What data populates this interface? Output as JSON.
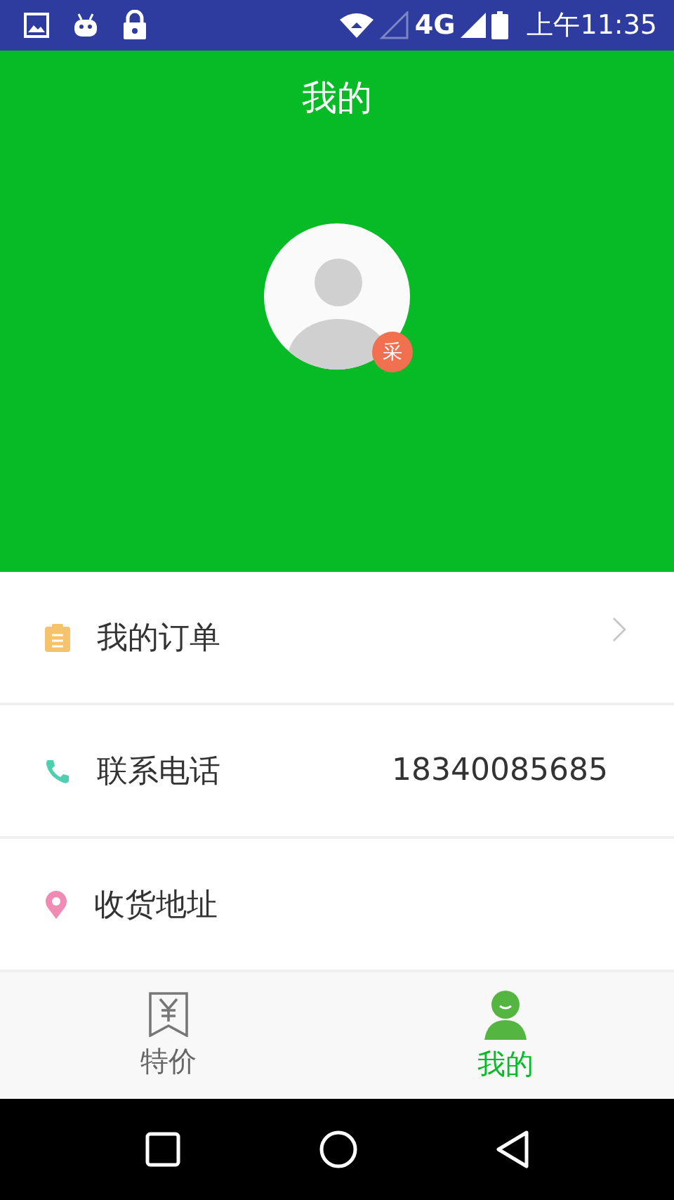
{
  "status_bar": {
    "network": "4G",
    "time": "上午11:35"
  },
  "header": {
    "title": "我的",
    "avatar_badge": "采"
  },
  "menu": [
    {
      "kind": "order",
      "label": "我的订单",
      "chevron": true
    },
    {
      "kind": "phone",
      "label": "联系电话",
      "value": "18340085685",
      "chevron": false
    },
    {
      "kind": "address",
      "label": "收货地址",
      "chevron": false
    }
  ],
  "tabs": [
    {
      "kind": "deals",
      "label": "特价",
      "selected": false
    },
    {
      "kind": "profile",
      "label": "我的",
      "selected": true
    }
  ]
}
